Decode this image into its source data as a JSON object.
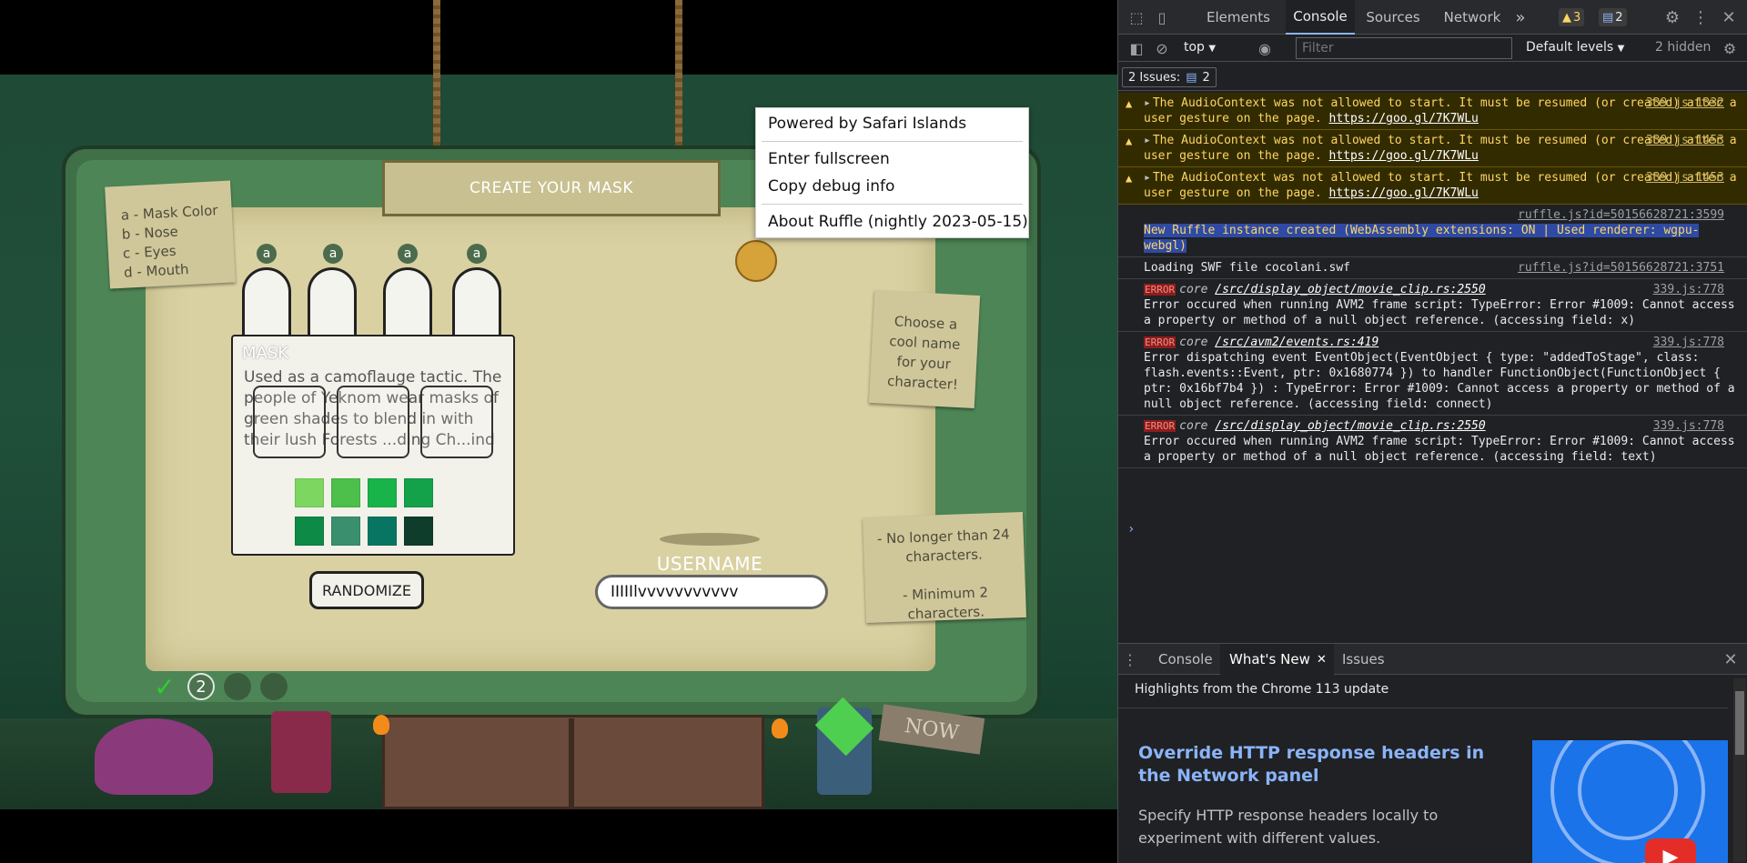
{
  "game": {
    "banner_title": "CREATE YOUR MASK",
    "legend": [
      "a - Mask Color",
      "b - Nose",
      "c - Eyes",
      "d - Mouth"
    ],
    "slot_letters": [
      "a",
      "a",
      "a",
      "a"
    ],
    "mask_panel": {
      "title": "MASK",
      "description": "Used as a camoflauge tactic. The people of Yeknom wear masks of green shades to blend in with their lush Forests ...ding Ch...ind"
    },
    "swatches": [
      "#7cd65f",
      "#4cc04a",
      "#19b449",
      "#13a14a",
      "#0d8a45",
      "#3a8f6e",
      "#087563",
      "#0e3d2b"
    ],
    "randomize_label": "RANDOMIZE",
    "username_label": "USERNAME",
    "username_value": "IIIIIlvvvvvvvvvvv",
    "choose_note": "Choose a cool name for your character!",
    "rules_note": "- No longer than 24 characters.\n\n- Minimum 2 characters.",
    "progress": {
      "check": "✓",
      "current": "2"
    },
    "now_sign": "NOW",
    "context_menu": {
      "header": "Powered by Safari Islands",
      "items": [
        "Enter fullscreen",
        "Copy debug info"
      ],
      "footer": "About Ruffle (nightly 2023-05-15)"
    }
  },
  "devtools": {
    "tabs": [
      "Elements",
      "Console",
      "Sources",
      "Network"
    ],
    "active_tab": "Console",
    "more_tabs": "»",
    "warn_count": "3",
    "msg_count": "2",
    "toolbar": {
      "context": "top",
      "filter_placeholder": "Filter",
      "levels": "Default levels",
      "hidden": "2 hidden"
    },
    "issues": {
      "label": "2 Issues:",
      "count": "2"
    },
    "messages": [
      {
        "level": "warn",
        "text": "The AudioContext was not allowed to start. It must be resumed (or created) after a user gesture on the page.",
        "link": "https://goo.gl/7K7WLu",
        "src": "339.js:1332"
      },
      {
        "level": "warn",
        "text": "The AudioContext was not allowed to start. It must be resumed (or created) after a user gesture on the page.",
        "link": "https://goo.gl/7K7WLu",
        "src": "339.js:1453"
      },
      {
        "level": "warn",
        "text": "The AudioContext was not allowed to start. It must be resumed (or created) after a user gesture on the page.",
        "link": "https://goo.gl/7K7WLu",
        "src": "339.js:1453"
      },
      {
        "level": "info",
        "src": "ruffle.js?id=50156628721:3599",
        "text": "New Ruffle instance created (WebAssembly extensions: ON | Used renderer: wgpu-webgl)"
      },
      {
        "level": "info",
        "src": "ruffle.js?id=50156628721:3751",
        "text": "Loading SWF file cocolani.swf"
      },
      {
        "level": "error",
        "tag": "ERROR",
        "core": "core",
        "path": "/src/display_object/movie_clip.rs:2550",
        "src": "339.js:778",
        "text": "Error occured when running AVM2 frame script: TypeError: Error #1009: Cannot access a property or method of a null object reference. (accessing field: x)"
      },
      {
        "level": "error",
        "tag": "ERROR",
        "core": "core",
        "path": "/src/avm2/events.rs:419",
        "src": "339.js:778",
        "text": "Error dispatching event EventObject(EventObject { type: \"addedToStage\", class: flash.events::Event, ptr: 0x1680774 }) to handler FunctionObject(FunctionObject { ptr: 0x16bf7b4 }) : TypeError: Error #1009: Cannot access a property or method of a null object reference. (accessing field: connect)"
      },
      {
        "level": "error",
        "tag": "ERROR",
        "core": "core",
        "path": "/src/display_object/movie_clip.rs:2550",
        "src": "339.js:778",
        "text": "Error occured when running AVM2 frame script: TypeError: Error #1009: Cannot access a property or method of a null object reference. (accessing field: text)"
      }
    ],
    "prompt": "›",
    "drawer": {
      "tabs": [
        "Console",
        "What's New",
        "Issues"
      ],
      "active": "What's New",
      "highlights": "Highlights from the Chrome 113 update",
      "feature_title": "Override HTTP response headers in the Network panel",
      "feature_desc": "Specify HTTP response headers locally to experiment with different values."
    }
  }
}
